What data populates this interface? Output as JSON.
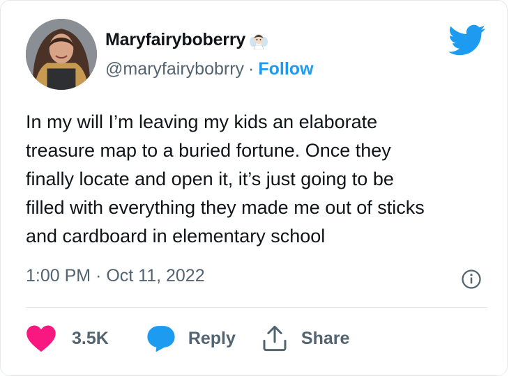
{
  "author": {
    "display_name": "Maryfairyboberry",
    "name_emoji_icon": "fairy-emoji-icon",
    "handle": "@maryfairybobrry",
    "separator": "·",
    "follow_label": "Follow",
    "avatar_icon": "profile-photo"
  },
  "brand": {
    "icon": "twitter-bird-icon",
    "color": "#1d9bf0"
  },
  "tweet": {
    "text": "In my will I’m leaving my kids an elaborate\ntreasure map to a buried fortune. Once they\nfinally locate and open it, it’s just going to be\nfilled with everything they made me out of sticks\nand cardboard in elementary school",
    "timestamp": "1:00 PM · Oct 11, 2022"
  },
  "actions": {
    "like_count": "3.5K",
    "like_color": "#f91880",
    "reply_label": "Reply",
    "reply_color": "#1d9bf0",
    "share_label": "Share"
  },
  "colors": {
    "secondary_text": "#536471",
    "primary_text": "#0f1419"
  }
}
